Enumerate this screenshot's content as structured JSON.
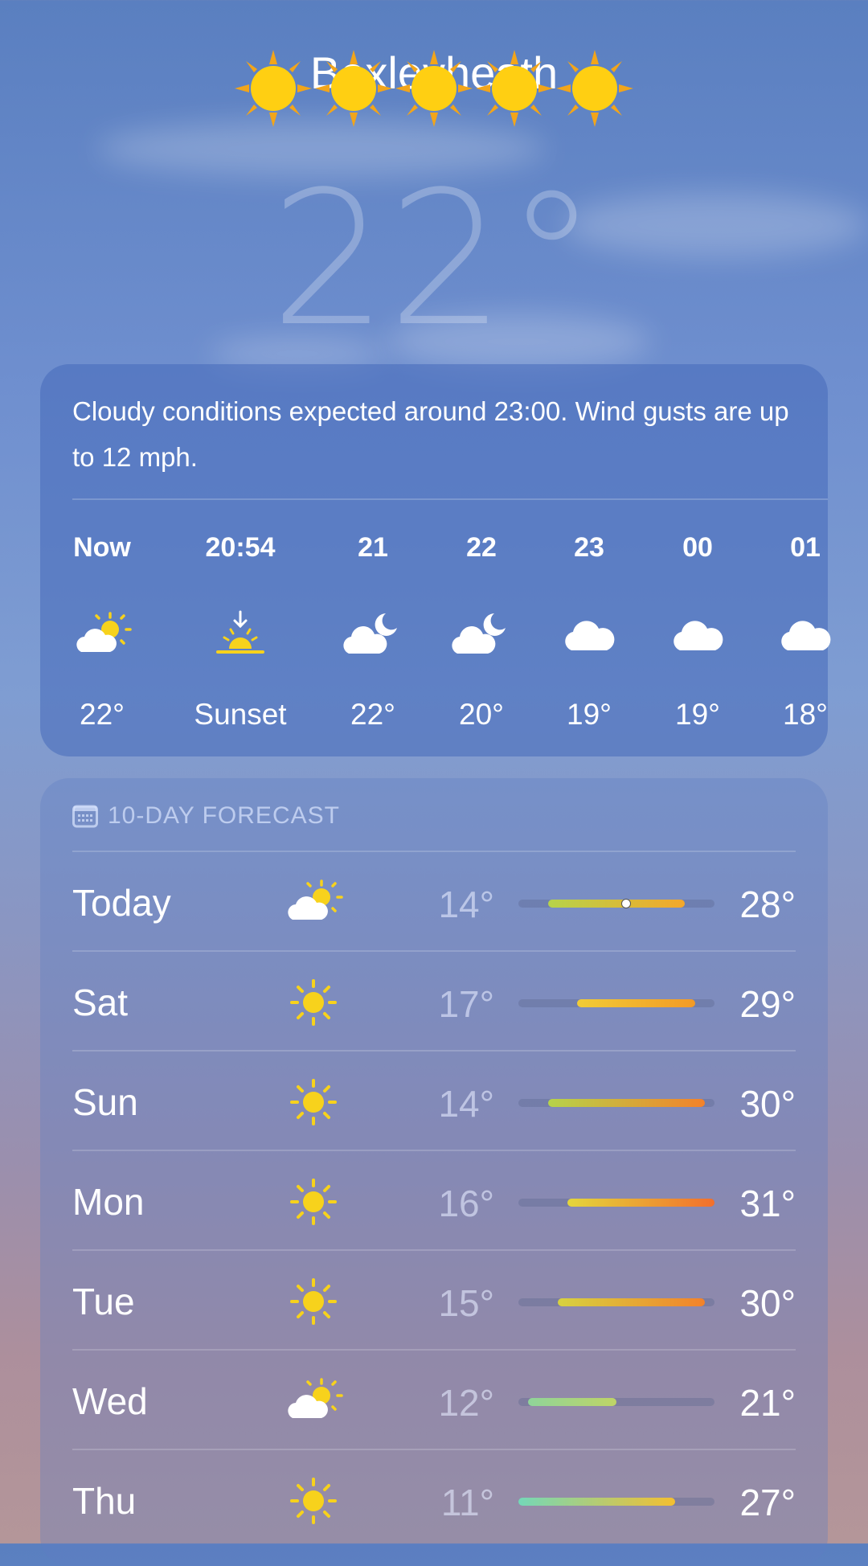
{
  "location": {
    "city": "Bexleyheath",
    "current_temp": "22°"
  },
  "summary": {
    "text": "Cloudy conditions expected around 23:00. Wind gusts are up to 12 mph."
  },
  "hourly": [
    {
      "label": "Now",
      "icon": "partly-sunny-icon",
      "temp": "22°"
    },
    {
      "label": "20:54",
      "icon": "sunset-icon",
      "temp": "Sunset"
    },
    {
      "label": "21",
      "icon": "cloud-moon-icon",
      "temp": "22°"
    },
    {
      "label": "22",
      "icon": "cloud-moon-icon",
      "temp": "20°"
    },
    {
      "label": "23",
      "icon": "cloud-icon",
      "temp": "19°"
    },
    {
      "label": "00",
      "icon": "cloud-icon",
      "temp": "19°"
    },
    {
      "label": "01",
      "icon": "cloud-icon",
      "temp": "18°"
    }
  ],
  "forecast": {
    "title": "10-DAY FORECAST",
    "range_min": 11,
    "range_max": 31,
    "days": [
      {
        "day": "Today",
        "icon": "partly-sunny-icon",
        "low": "14°",
        "high": "28°",
        "low_val": 14,
        "high_val": 28,
        "current": 22,
        "from": "#b6d34a",
        "to": "#f4a72a"
      },
      {
        "day": "Sat",
        "icon": "sun-icon",
        "low": "17°",
        "high": "29°",
        "low_val": 17,
        "high_val": 29,
        "from": "#f1cc36",
        "to": "#f39a26"
      },
      {
        "day": "Sun",
        "icon": "sun-icon",
        "low": "14°",
        "high": "30°",
        "low_val": 14,
        "high_val": 30,
        "from": "#b6d34a",
        "to": "#f3822a"
      },
      {
        "day": "Mon",
        "icon": "sun-icon",
        "low": "16°",
        "high": "31°",
        "low_val": 16,
        "high_val": 31,
        "from": "#e4d63b",
        "to": "#f26f2c"
      },
      {
        "day": "Tue",
        "icon": "sun-icon",
        "low": "15°",
        "high": "30°",
        "low_val": 15,
        "high_val": 30,
        "from": "#d7d240",
        "to": "#f3822a"
      },
      {
        "day": "Wed",
        "icon": "partly-sunny-icon",
        "low": "12°",
        "high": "21°",
        "low_val": 12,
        "high_val": 21,
        "from": "#8fd49a",
        "to": "#bfd466"
      },
      {
        "day": "Thu",
        "icon": "sun-icon",
        "low": "11°",
        "high": "27°",
        "low_val": 11,
        "high_val": 27,
        "from": "#74d8b8",
        "to": "#f4bf30"
      }
    ]
  },
  "colors": {
    "sun": "#f7d21c",
    "moon": "#ece6f2"
  }
}
